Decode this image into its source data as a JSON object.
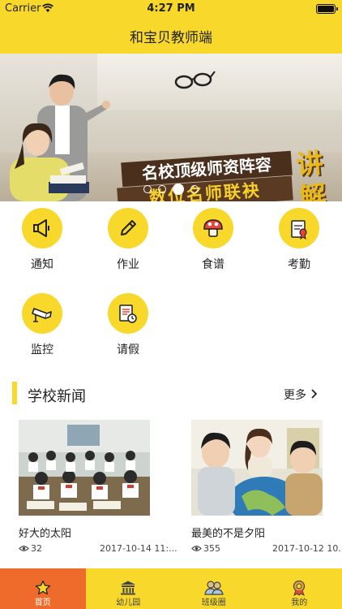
{
  "status": {
    "carrier": "Carrier",
    "time": "4:27 PM"
  },
  "nav": {
    "title": "和宝贝教师端"
  },
  "banner": {
    "line1": "名校顶级师资阵容",
    "line2": "数位名师联袂",
    "line3": "讲解",
    "slides": 4,
    "active_slide": 3
  },
  "grid": [
    {
      "label": "通知",
      "icon": "megaphone-icon"
    },
    {
      "label": "作业",
      "icon": "pencil-icon"
    },
    {
      "label": "食谱",
      "icon": "mushroom-icon"
    },
    {
      "label": "考勤",
      "icon": "certificate-icon"
    },
    {
      "label": "监控",
      "icon": "camera-icon"
    },
    {
      "label": "请假",
      "icon": "leave-form-icon"
    }
  ],
  "section": {
    "title": "学校新闻",
    "more": "更多"
  },
  "news": [
    {
      "title": "好大的太阳",
      "views": "32",
      "date": "2017-10-14 11:..."
    },
    {
      "title": "最美的不是夕阳",
      "views": "355",
      "date": "2017-10-12 10..."
    }
  ],
  "tabs": [
    {
      "label": "首页",
      "icon": "star-icon",
      "active": true
    },
    {
      "label": "幼儿园",
      "icon": "building-icon",
      "active": false
    },
    {
      "label": "班级圈",
      "icon": "people-icon",
      "active": false
    },
    {
      "label": "我的",
      "icon": "badge-icon",
      "active": false
    }
  ],
  "colors": {
    "primary": "#f8d92b",
    "active_tab": "#ef6b2b"
  }
}
